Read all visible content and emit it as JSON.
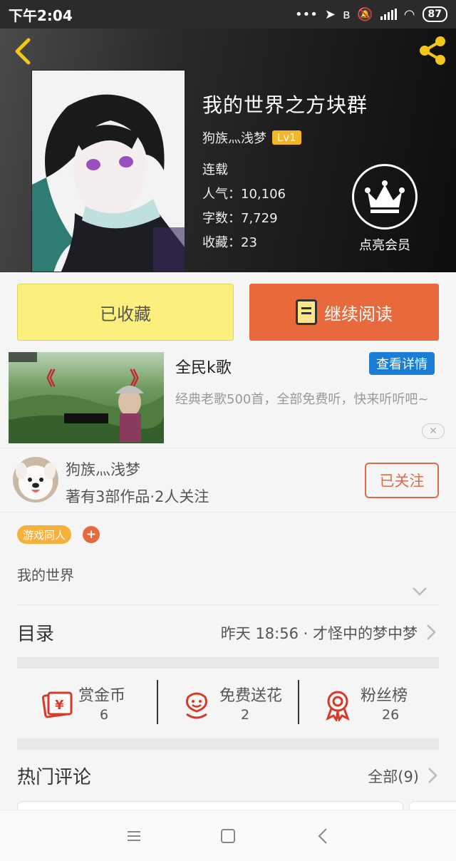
{
  "status_bar": {
    "time": "下午2:04",
    "battery": "87"
  },
  "book": {
    "title": "我的世界之方块群",
    "author": "狗族灬浅梦",
    "level": "Lv1",
    "status": "连载",
    "popularity": "人气：10,106",
    "word_count": "字数：7,729",
    "favorites": "收藏：23",
    "vip_label": "点亮会员"
  },
  "actions": {
    "favorited_label": "已收藏",
    "continue_label": "继续阅读"
  },
  "ad": {
    "title": "全民k歌",
    "detail_label": "查看详情",
    "description": "经典老歌500首，全部免费听，快来听听吧~",
    "close_label": "✕"
  },
  "author": {
    "name": "狗族灬浅梦",
    "works": "著有3部作品·2人关注",
    "follow_label": "已关注"
  },
  "tags": {
    "items": [
      "游戏同人"
    ],
    "add_label": "+"
  },
  "summary": "我的世界",
  "catalog": {
    "label": "目录",
    "latest": "昨天 18:56 · 才怪中的梦中梦"
  },
  "stats": [
    {
      "label": "赏金币",
      "value": "6",
      "icon": "coin-card-icon"
    },
    {
      "label": "免费送花",
      "value": "2",
      "icon": "flower-icon"
    },
    {
      "label": "粉丝榜",
      "value": "26",
      "icon": "medal-icon"
    }
  ],
  "comments": {
    "title": "热门评论",
    "all_label": "全部(9)"
  },
  "colors": {
    "accent_orange": "#e8693c",
    "favorite_yellow": "#fbef7e",
    "tag_orange": "#f7b13a",
    "level_badge": "#f5b52a",
    "ad_blue": "#1a7dd6"
  }
}
